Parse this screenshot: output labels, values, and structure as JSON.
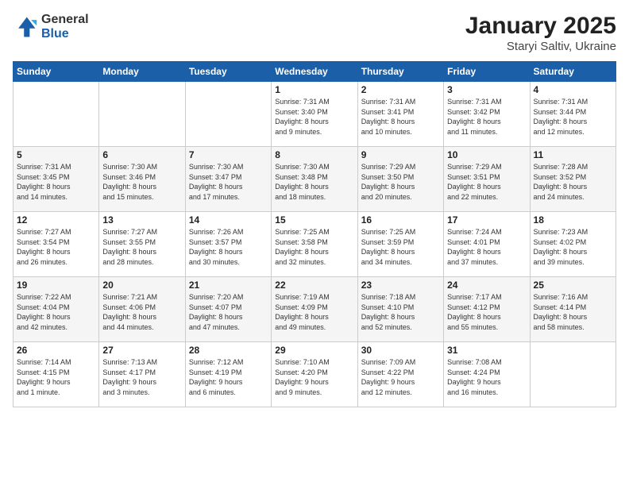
{
  "logo": {
    "general": "General",
    "blue": "Blue"
  },
  "title": "January 2025",
  "location": "Staryi Saltiv, Ukraine",
  "days_header": [
    "Sunday",
    "Monday",
    "Tuesday",
    "Wednesday",
    "Thursday",
    "Friday",
    "Saturday"
  ],
  "weeks": [
    [
      {
        "day": "",
        "info": ""
      },
      {
        "day": "",
        "info": ""
      },
      {
        "day": "",
        "info": ""
      },
      {
        "day": "1",
        "info": "Sunrise: 7:31 AM\nSunset: 3:40 PM\nDaylight: 8 hours\nand 9 minutes."
      },
      {
        "day": "2",
        "info": "Sunrise: 7:31 AM\nSunset: 3:41 PM\nDaylight: 8 hours\nand 10 minutes."
      },
      {
        "day": "3",
        "info": "Sunrise: 7:31 AM\nSunset: 3:42 PM\nDaylight: 8 hours\nand 11 minutes."
      },
      {
        "day": "4",
        "info": "Sunrise: 7:31 AM\nSunset: 3:44 PM\nDaylight: 8 hours\nand 12 minutes."
      }
    ],
    [
      {
        "day": "5",
        "info": "Sunrise: 7:31 AM\nSunset: 3:45 PM\nDaylight: 8 hours\nand 14 minutes."
      },
      {
        "day": "6",
        "info": "Sunrise: 7:30 AM\nSunset: 3:46 PM\nDaylight: 8 hours\nand 15 minutes."
      },
      {
        "day": "7",
        "info": "Sunrise: 7:30 AM\nSunset: 3:47 PM\nDaylight: 8 hours\nand 17 minutes."
      },
      {
        "day": "8",
        "info": "Sunrise: 7:30 AM\nSunset: 3:48 PM\nDaylight: 8 hours\nand 18 minutes."
      },
      {
        "day": "9",
        "info": "Sunrise: 7:29 AM\nSunset: 3:50 PM\nDaylight: 8 hours\nand 20 minutes."
      },
      {
        "day": "10",
        "info": "Sunrise: 7:29 AM\nSunset: 3:51 PM\nDaylight: 8 hours\nand 22 minutes."
      },
      {
        "day": "11",
        "info": "Sunrise: 7:28 AM\nSunset: 3:52 PM\nDaylight: 8 hours\nand 24 minutes."
      }
    ],
    [
      {
        "day": "12",
        "info": "Sunrise: 7:27 AM\nSunset: 3:54 PM\nDaylight: 8 hours\nand 26 minutes."
      },
      {
        "day": "13",
        "info": "Sunrise: 7:27 AM\nSunset: 3:55 PM\nDaylight: 8 hours\nand 28 minutes."
      },
      {
        "day": "14",
        "info": "Sunrise: 7:26 AM\nSunset: 3:57 PM\nDaylight: 8 hours\nand 30 minutes."
      },
      {
        "day": "15",
        "info": "Sunrise: 7:25 AM\nSunset: 3:58 PM\nDaylight: 8 hours\nand 32 minutes."
      },
      {
        "day": "16",
        "info": "Sunrise: 7:25 AM\nSunset: 3:59 PM\nDaylight: 8 hours\nand 34 minutes."
      },
      {
        "day": "17",
        "info": "Sunrise: 7:24 AM\nSunset: 4:01 PM\nDaylight: 8 hours\nand 37 minutes."
      },
      {
        "day": "18",
        "info": "Sunrise: 7:23 AM\nSunset: 4:02 PM\nDaylight: 8 hours\nand 39 minutes."
      }
    ],
    [
      {
        "day": "19",
        "info": "Sunrise: 7:22 AM\nSunset: 4:04 PM\nDaylight: 8 hours\nand 42 minutes."
      },
      {
        "day": "20",
        "info": "Sunrise: 7:21 AM\nSunset: 4:06 PM\nDaylight: 8 hours\nand 44 minutes."
      },
      {
        "day": "21",
        "info": "Sunrise: 7:20 AM\nSunset: 4:07 PM\nDaylight: 8 hours\nand 47 minutes."
      },
      {
        "day": "22",
        "info": "Sunrise: 7:19 AM\nSunset: 4:09 PM\nDaylight: 8 hours\nand 49 minutes."
      },
      {
        "day": "23",
        "info": "Sunrise: 7:18 AM\nSunset: 4:10 PM\nDaylight: 8 hours\nand 52 minutes."
      },
      {
        "day": "24",
        "info": "Sunrise: 7:17 AM\nSunset: 4:12 PM\nDaylight: 8 hours\nand 55 minutes."
      },
      {
        "day": "25",
        "info": "Sunrise: 7:16 AM\nSunset: 4:14 PM\nDaylight: 8 hours\nand 58 minutes."
      }
    ],
    [
      {
        "day": "26",
        "info": "Sunrise: 7:14 AM\nSunset: 4:15 PM\nDaylight: 9 hours\nand 1 minute."
      },
      {
        "day": "27",
        "info": "Sunrise: 7:13 AM\nSunset: 4:17 PM\nDaylight: 9 hours\nand 3 minutes."
      },
      {
        "day": "28",
        "info": "Sunrise: 7:12 AM\nSunset: 4:19 PM\nDaylight: 9 hours\nand 6 minutes."
      },
      {
        "day": "29",
        "info": "Sunrise: 7:10 AM\nSunset: 4:20 PM\nDaylight: 9 hours\nand 9 minutes."
      },
      {
        "day": "30",
        "info": "Sunrise: 7:09 AM\nSunset: 4:22 PM\nDaylight: 9 hours\nand 12 minutes."
      },
      {
        "day": "31",
        "info": "Sunrise: 7:08 AM\nSunset: 4:24 PM\nDaylight: 9 hours\nand 16 minutes."
      },
      {
        "day": "",
        "info": ""
      }
    ]
  ]
}
